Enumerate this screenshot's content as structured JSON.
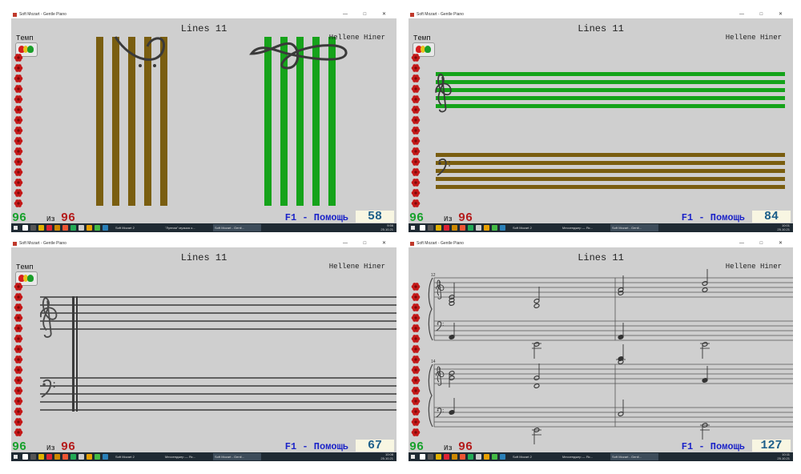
{
  "colors": {
    "green_score": "#17a12c",
    "red_score": "#b41c1c",
    "help_blue": "#1c24c8",
    "counter_blue": "#1d5f8a",
    "brown_lines": "#7a5e10",
    "green_lines": "#15a31a",
    "background": "#cfcfcf"
  },
  "panels": [
    {
      "window_title": "Soft Mozart - Gentle Piano",
      "window_buttons": "— □ ✕",
      "lesson": "Lines 11",
      "author": "Hellene Hiner",
      "tempo_label": "Темп",
      "score": "96",
      "of_label": "Из",
      "total": "96",
      "help": "F1 - Помощь",
      "counter": "58",
      "taskbar_items": [
        "Soft Mozart 2",
        "\"Лунная\" музыка о...",
        "Soft Mozart - Gentl..."
      ],
      "clock_time": "9:56",
      "clock_date": "25.10.21"
    },
    {
      "window_title": "Soft Mozart - Gentle Piano",
      "window_buttons": "— □ ✕",
      "lesson": "Lines 11",
      "author": "Hellene Hiner",
      "tempo_label": "Темп",
      "score": "96",
      "of_label": "Из",
      "total": "96",
      "help": "F1 - Помощь",
      "counter": "84",
      "taskbar_items": [
        "Soft Mozart 2",
        "Мессенджер — Яс...",
        "Soft Mozart - Gentl..."
      ],
      "clock_time": "10:01",
      "clock_date": "25.10.21"
    },
    {
      "window_title": "Soft Mozart - Gentle Piano",
      "window_buttons": "— □ ✕",
      "lesson": "Lines 11",
      "author": "Hellene Hiner",
      "tempo_label": "Темп",
      "score": "96",
      "of_label": "Из",
      "total": "96",
      "help": "F1 - Помощь",
      "counter": "67",
      "taskbar_items": [
        "Soft Mozart 2",
        "Мессенджер — Яс...",
        "Soft Mozart - Gentl..."
      ],
      "clock_time": "10:08",
      "clock_date": "25.10.21"
    },
    {
      "window_title": "Soft Mozart - Gentle Piano",
      "window_buttons": "— □ ✕",
      "lesson": "Lines 11",
      "author": "Hellene Hiner",
      "tempo_label": "",
      "score": "96",
      "of_label": "Из",
      "total": "96",
      "help": "F1 - Помощь",
      "counter": "127",
      "measure_number_1": "12",
      "measure_number_2": "14",
      "taskbar_items": [
        "Soft Mozart 2",
        "Мессенджер — Яс...",
        "Soft Mozart - Gentl..."
      ],
      "clock_time": "10:11",
      "clock_date": "25.10.21"
    }
  ]
}
